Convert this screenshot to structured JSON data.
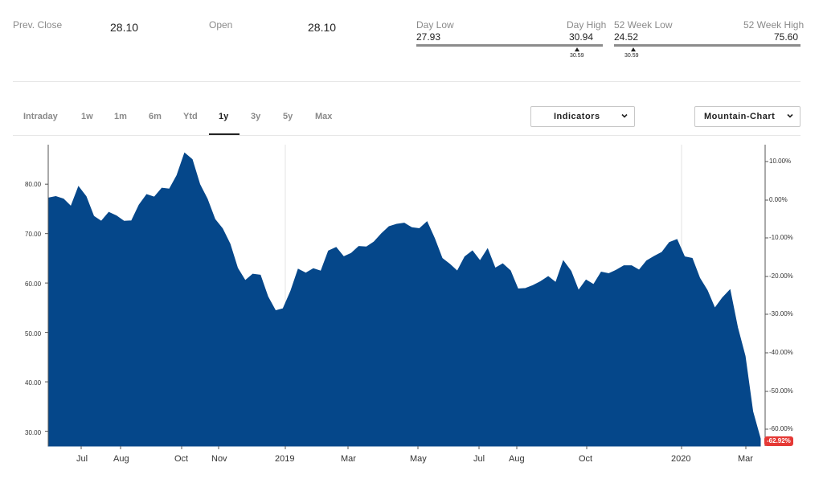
{
  "stats": {
    "prev_close_label": "Prev. Close",
    "prev_close_value": "28.10",
    "open_label": "Open",
    "open_value": "28.10",
    "day_low_label": "Day Low",
    "day_low_value": "27.93",
    "day_high_label": "Day High",
    "day_high_value": "30.94",
    "day_marker": "30.59",
    "week52_low_label": "52 Week Low",
    "week52_low_value": "24.52",
    "week52_high_label": "52 Week High",
    "week52_high_value": "75.60",
    "week52_marker": "30.59"
  },
  "tabs": [
    {
      "label": "Intraday"
    },
    {
      "label": "1w"
    },
    {
      "label": "1m"
    },
    {
      "label": "6m"
    },
    {
      "label": "Ytd"
    },
    {
      "label": "1y"
    },
    {
      "label": "3y"
    },
    {
      "label": "5y"
    },
    {
      "label": "Max"
    }
  ],
  "active_tab": "1y",
  "indicators_label": "Indicators",
  "chart_type_label": "Mountain-Chart",
  "current_change_badge": "-62.92%",
  "colors": {
    "area_fill": "#05478A",
    "badge": "#E53935",
    "range_bar": "#8C8C8C"
  },
  "chart_data": {
    "type": "area",
    "x_tick_labels": [
      "Jul",
      "Aug",
      "Oct",
      "Nov",
      "2019",
      "Mar",
      "May",
      "Jul",
      "Aug",
      "Oct",
      "2020",
      "Mar"
    ],
    "y_tick_labels_left": [
      "80.00",
      "70.00",
      "60.00",
      "50.00",
      "40.00",
      "30.00"
    ],
    "y_tick_labels_right": [
      "10.00%",
      "0.00%",
      "-10.00%",
      "-20.00%",
      "-30.00%",
      "-40.00%",
      "-50.00%",
      "-60.00%"
    ],
    "ylim": [
      27,
      88
    ],
    "grid": "vertical lines at 2019 and 2020",
    "series": [
      {
        "values": [
          77.2,
          77.5,
          77.0,
          75.5,
          79.5,
          77.5,
          73.5,
          72.5,
          74.3,
          73.6,
          72.5,
          72.6,
          75.8,
          77.9,
          77.4,
          79.2,
          79.0,
          81.8,
          86.3,
          85.0,
          80.0,
          77.0,
          72.9,
          71.0,
          67.9,
          63.0,
          60.5,
          61.8,
          61.6,
          57.2,
          54.4,
          54.8,
          58.3,
          62.8,
          62.0,
          62.9,
          62.4,
          66.5,
          67.2,
          65.3,
          66.0,
          67.4,
          67.3,
          68.3,
          70.0,
          71.4,
          71.9,
          72.1,
          71.2,
          71.0,
          72.4,
          69.0,
          65.0,
          63.8,
          62.4,
          65.3,
          66.5,
          64.5,
          66.9,
          63.0,
          63.9,
          62.5,
          58.8,
          58.9,
          59.5,
          60.3,
          61.3,
          60.1,
          64.5,
          62.4,
          58.5,
          60.6,
          59.7,
          62.2,
          61.9,
          62.6,
          63.5,
          63.5,
          62.6,
          64.5,
          65.4,
          66.2,
          68.2,
          68.8,
          65.3,
          65.0,
          61.0,
          58.5,
          54.9,
          57.0,
          58.6,
          51.0,
          45.2,
          34.0,
          28.5
        ]
      }
    ]
  }
}
